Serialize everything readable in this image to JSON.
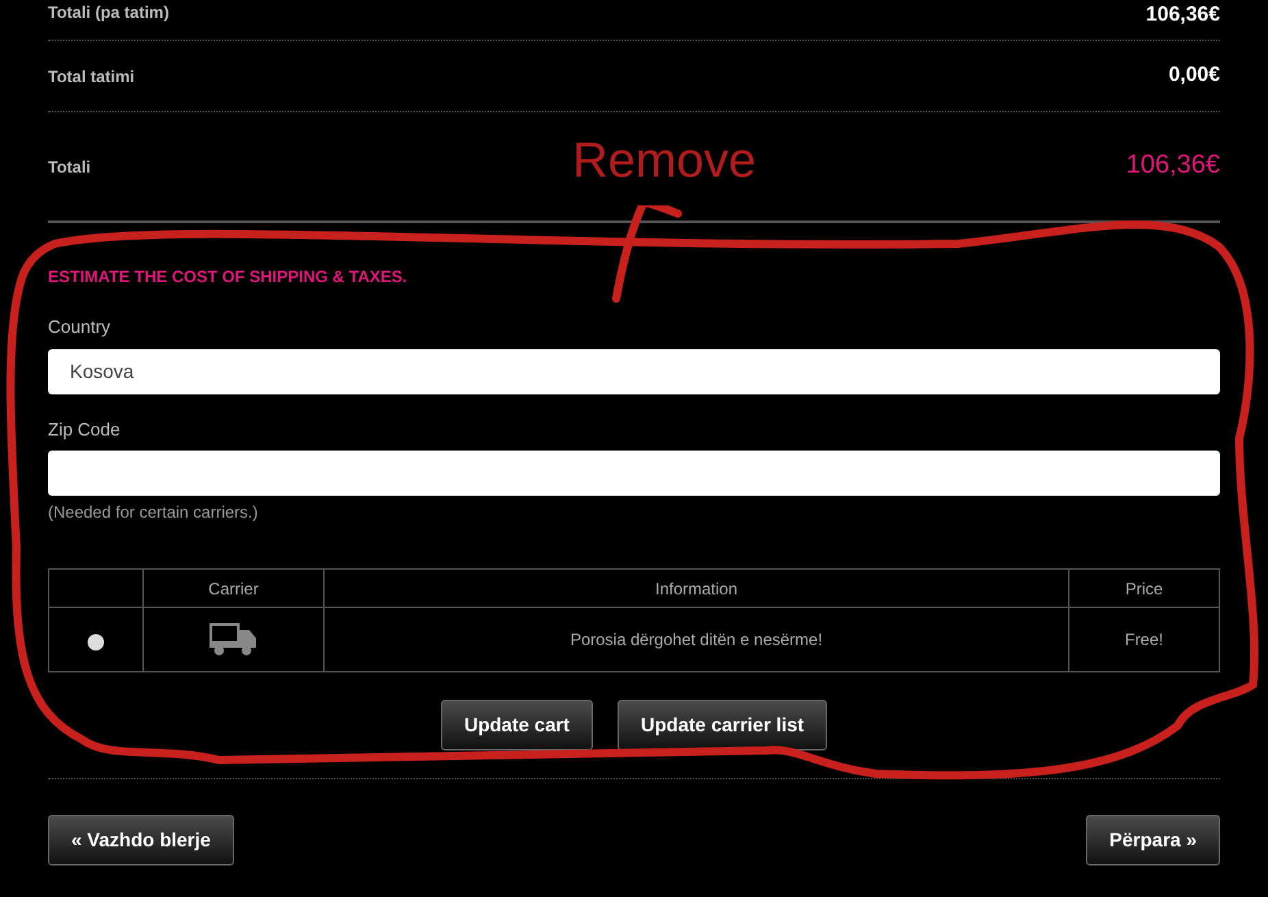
{
  "summary": [
    {
      "label": "Totali (pa tatim)",
      "value": "106,36€",
      "kind": "plain"
    },
    {
      "label": "Total tatimi",
      "value": "0,00€",
      "kind": "plain"
    },
    {
      "label": "Totali",
      "value": "106,36€",
      "kind": "total"
    }
  ],
  "shipping": {
    "heading": "ESTIMATE THE COST OF SHIPPING & TAXES.",
    "country": {
      "label": "Country",
      "value": "Kosova"
    },
    "zip": {
      "label": "Zip Code"
    },
    "note": "(Needed for certain carriers.)",
    "table": {
      "columns": [
        "Carrier",
        "Information",
        "Price"
      ],
      "rows": [
        {
          "selected": false,
          "information": "Porosia dërgohet ditën e nesërme!",
          "price": "Free!"
        }
      ]
    },
    "buttons": [
      "Update cart",
      "Update carrier list"
    ]
  },
  "nav": {
    "back": "« Vazhdo blerje",
    "next": "Përpara »"
  },
  "annotation": {
    "text": "Remove"
  }
}
